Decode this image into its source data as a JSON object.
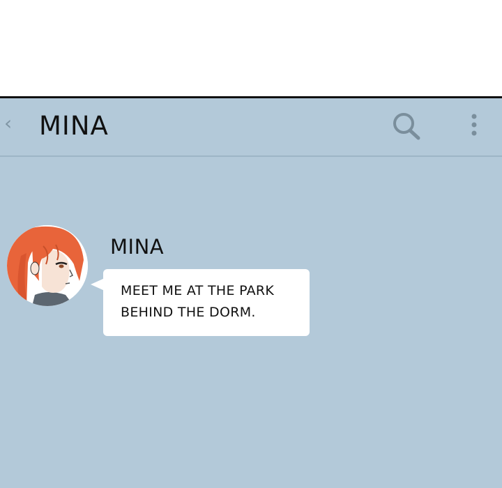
{
  "header": {
    "back_icon": "chevron-left-icon",
    "back_glyph": "‹",
    "title": "MINA",
    "search_icon": "search-icon",
    "more_icon": "more-vertical-icon"
  },
  "conversation": {
    "messages": [
      {
        "sender": "MINA",
        "avatar_icon": "avatar",
        "lines": [
          "MEET ME AT THE PARK",
          "BEHIND THE DORM."
        ]
      }
    ]
  },
  "colors": {
    "chat_background": "#b3c9d9",
    "bubble": "#ffffff",
    "text": "#111111",
    "icon": "#7a8e9c",
    "hair": "#e8643a"
  }
}
